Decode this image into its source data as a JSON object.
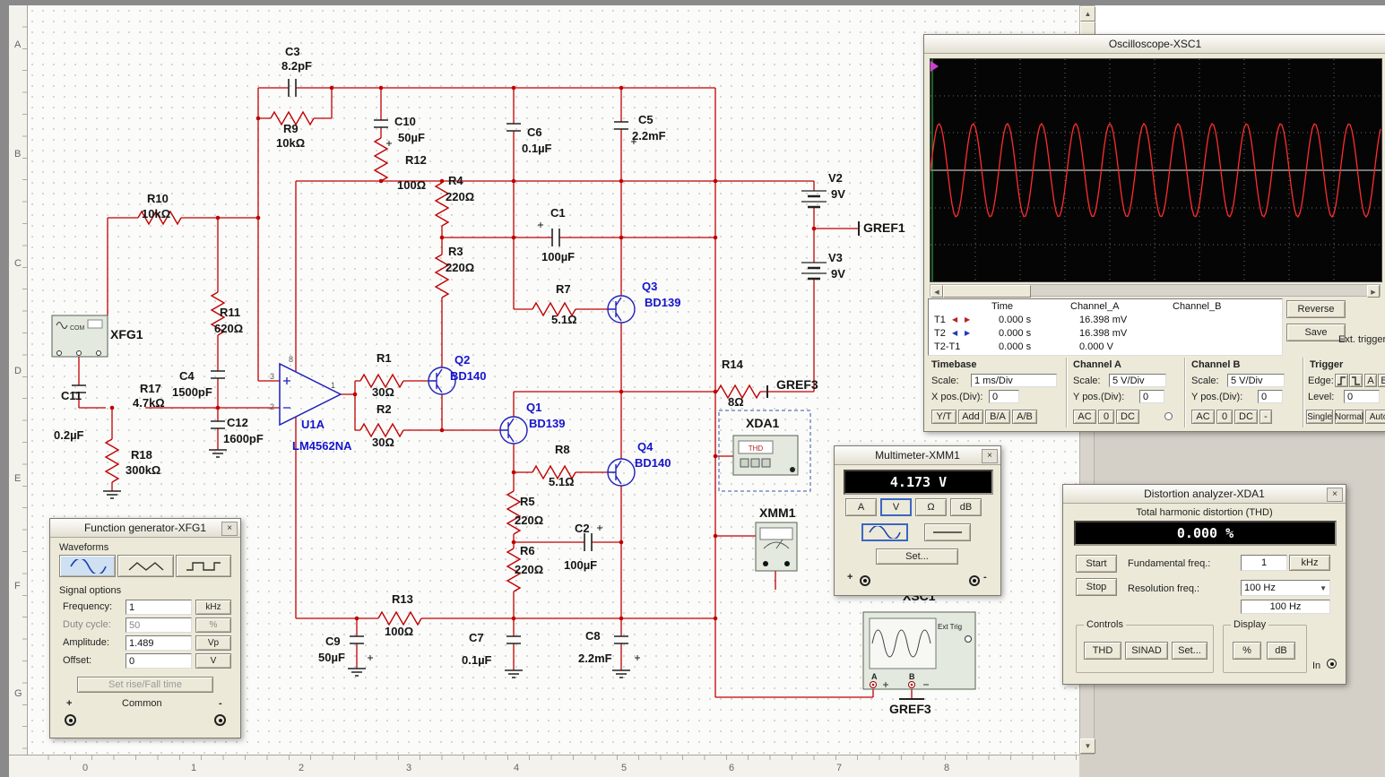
{
  "glyphs": {
    "close": "×",
    "left": "◀",
    "right": "▶",
    "up": "▲",
    "down": "▼"
  },
  "rulers": {
    "rows": [
      "A",
      "B",
      "C",
      "D",
      "E",
      "F",
      "G"
    ],
    "cols": [
      "0",
      "1",
      "2",
      "3",
      "4",
      "5",
      "6",
      "7",
      "8"
    ]
  },
  "sch": {
    "c3": {
      "r": "C3",
      "v": "8.2pF"
    },
    "r9": {
      "r": "R9",
      "v": "10kΩ"
    },
    "r10": {
      "r": "R10",
      "v": "10kΩ"
    },
    "c10": {
      "r": "C10",
      "v": "50µF"
    },
    "r12": {
      "r": "R12",
      "v": "100Ω"
    },
    "r4": {
      "r": "R4",
      "v": "220Ω"
    },
    "c6": {
      "r": "C6",
      "v": "0.1µF"
    },
    "c5": {
      "r": "C5",
      "v": "2.2mF"
    },
    "c1": {
      "r": "C1",
      "v": "100µF"
    },
    "r3": {
      "r": "R3",
      "v": "220Ω"
    },
    "r7": {
      "r": "R7",
      "v": "5.1Ω"
    },
    "q3": {
      "r": "Q3",
      "v": "BD139"
    },
    "v2": {
      "r": "V2",
      "v": "9V"
    },
    "v3": {
      "r": "V3",
      "v": "9V"
    },
    "gref1": {
      "r": "GREF1"
    },
    "r11": {
      "r": "R11",
      "v": "620Ω"
    },
    "c4": {
      "r": "C4",
      "v": "1500pF"
    },
    "r17": {
      "r": "R17",
      "v": "4.7kΩ"
    },
    "c11": {
      "r": "C11",
      "v": "0.2µF"
    },
    "c12": {
      "r": "C12",
      "v": "1600pF"
    },
    "r18": {
      "r": "R18",
      "v": "300kΩ"
    },
    "u1a": {
      "r": "U1A",
      "v": "LM4562NA"
    },
    "r1": {
      "r": "R1",
      "v": "30Ω"
    },
    "q2": {
      "r": "Q2",
      "v": "BD140"
    },
    "r2": {
      "r": "R2",
      "v": "30Ω"
    },
    "q1": {
      "r": "Q1",
      "v": "BD139"
    },
    "r8": {
      "r": "R8",
      "v": "5.1Ω"
    },
    "q4": {
      "r": "Q4",
      "v": "BD140"
    },
    "r5": {
      "r": "R5",
      "v": "220Ω"
    },
    "r6": {
      "r": "R6",
      "v": "220Ω"
    },
    "c2": {
      "r": "C2",
      "v": "100µF"
    },
    "r14": {
      "r": "R14",
      "v": "8Ω"
    },
    "gref3": {
      "r": "GREF3"
    },
    "xda1": {
      "r": "XDA1"
    },
    "xmm1": {
      "r": "XMM1"
    },
    "xfg1": {
      "r": "XFG1"
    },
    "xsc1": {
      "r": "XSC1"
    },
    "r13": {
      "r": "R13",
      "v": "100Ω"
    },
    "c9": {
      "r": "C9",
      "v": "50µF"
    },
    "c7": {
      "r": "C7",
      "v": "0.1µF"
    },
    "c8": {
      "r": "C8",
      "v": "2.2mF"
    },
    "pins": {
      "p8": "8",
      "p3": "3",
      "p2": "2",
      "p1": "1"
    },
    "icons": {
      "com": "COM",
      "thd": "THD",
      "ext": "Ext Trig",
      "a": "A",
      "b": "B"
    }
  },
  "osc": {
    "title": "Oscilloscope-XSC1",
    "trace": {
      "cycles": 13.2,
      "amp": 52
    },
    "cols": {
      "time": "Time",
      "a": "Channel_A",
      "b": "Channel_B"
    },
    "rows": [
      {
        "n": "T1",
        "t": "0.000 s",
        "a": "16.398 mV",
        "b": ""
      },
      {
        "n": "T2",
        "t": "0.000 s",
        "a": "16.398 mV",
        "b": ""
      },
      {
        "n": "T2-T1",
        "t": "0.000 s",
        "a": "0.000 V",
        "b": ""
      }
    ],
    "reverse": "Reverse",
    "save": "Save",
    "ext": "Ext. trigger",
    "tb": {
      "h": "Timebase",
      "scale_l": "Scale:",
      "scale": "1 ms/Div",
      "pos_l": "X pos.(Div):",
      "pos": "0",
      "m": [
        "Y/T",
        "Add",
        "B/A",
        "A/B"
      ]
    },
    "ca": {
      "h": "Channel A",
      "scale_l": "Scale:",
      "scale": "5 V/Div",
      "pos_l": "Y pos.(Div):",
      "pos": "0",
      "m": [
        "AC",
        "0",
        "DC"
      ]
    },
    "cb": {
      "h": "Channel B",
      "scale_l": "Scale:",
      "scale": "5 V/Div",
      "pos_l": "Y pos.(Div):",
      "pos": "0",
      "m": [
        "AC",
        "0",
        "DC",
        "-"
      ]
    },
    "tr": {
      "h": "Trigger",
      "edge_l": "Edge:",
      "a": "A",
      "b": "B",
      "level_l": "Level:",
      "level": "0",
      "m": [
        "Single",
        "Normal",
        "Auto"
      ]
    }
  },
  "mm": {
    "title": "Multimeter-XMM1",
    "value": "4.173 V",
    "m": [
      "A",
      "V",
      "Ω",
      "dB"
    ],
    "set": "Set...",
    "plus": "+",
    "minus": "-"
  },
  "xda": {
    "title": "Distortion analyzer-XDA1",
    "sub": "Total harmonic distortion (THD)",
    "value": "0.000 %",
    "start": "Start",
    "stop": "Stop",
    "fund_l": "Fundamental freq.:",
    "fund": "1",
    "fund_u": "kHz",
    "res_l": "Resolution freq.:",
    "res": "100 Hz",
    "res2": "100 Hz",
    "controls": "Controls",
    "thd": "THD",
    "sinad": "SINAD",
    "set": "Set...",
    "disp": "Display",
    "pct": "%",
    "db": "dB",
    "in": "In"
  },
  "xfg": {
    "title": "Function generator-XFG1",
    "wf": "Waveforms",
    "so": "Signal options",
    "rows": [
      {
        "l": "Frequency:",
        "v": "1",
        "u": "kHz"
      },
      {
        "l": "Duty cycle:",
        "v": "50",
        "u": "%"
      },
      {
        "l": "Amplitude:",
        "v": "1.489",
        "u": "Vp"
      },
      {
        "l": "Offset:",
        "v": "0",
        "u": "V"
      }
    ],
    "rise": "Set rise/Fall time",
    "plus": "+",
    "common": "Common",
    "minus": "-"
  }
}
